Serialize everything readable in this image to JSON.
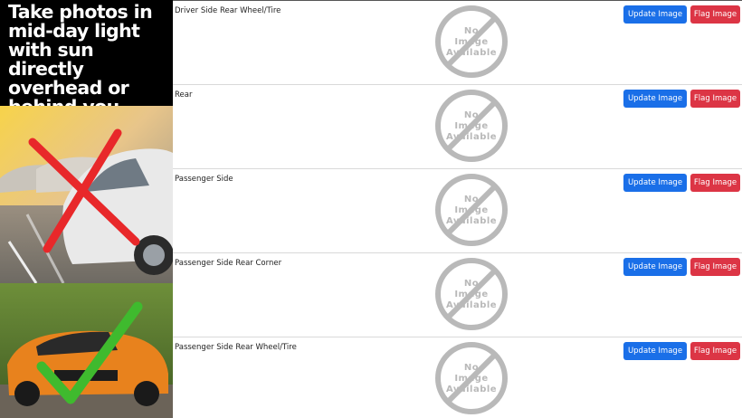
{
  "promo": {
    "text": "Take photos in\nmid-day light\nwith sun directly\noverhead or\nbehind you."
  },
  "placeholder": {
    "line1": "No",
    "line2": "Image",
    "line3": "Available"
  },
  "buttons": {
    "update_label": "Update Image",
    "flag_label": "Flag Image"
  },
  "colors": {
    "update": "#1a6fe8",
    "flag": "#dc3545",
    "placeholder_gray": "#b9b9b9"
  },
  "rows": [
    {
      "label": "Driver Side Rear Wheel/Tire"
    },
    {
      "label": "Rear"
    },
    {
      "label": "Passenger Side"
    },
    {
      "label": "Passenger Side Rear Corner"
    },
    {
      "label": "Passenger Side Rear Wheel/Tire"
    }
  ]
}
